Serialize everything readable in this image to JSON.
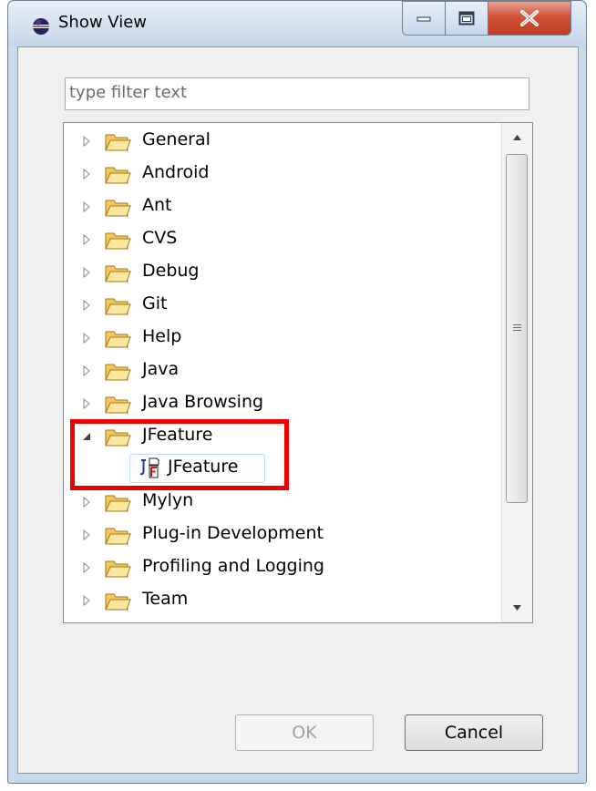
{
  "window": {
    "title": "Show View",
    "icon": "eclipse-icon",
    "controls": [
      "minimize-icon",
      "maximize-icon",
      "close-icon"
    ]
  },
  "filter": {
    "placeholder": "type filter text",
    "value": ""
  },
  "tree": {
    "items": [
      {
        "label": "General",
        "expanded": false
      },
      {
        "label": "Android",
        "expanded": false
      },
      {
        "label": "Ant",
        "expanded": false
      },
      {
        "label": "CVS",
        "expanded": false
      },
      {
        "label": "Debug",
        "expanded": false
      },
      {
        "label": "Git",
        "expanded": false
      },
      {
        "label": "Help",
        "expanded": false
      },
      {
        "label": "Java",
        "expanded": false
      },
      {
        "label": "Java Browsing",
        "expanded": false
      },
      {
        "label": "JFeature",
        "expanded": true,
        "children": [
          {
            "label": "JFeature",
            "icon": "jfeature-icon"
          }
        ]
      },
      {
        "label": "Mylyn",
        "expanded": false
      },
      {
        "label": "Plug-in Development",
        "expanded": false
      },
      {
        "label": "Profiling and Logging",
        "expanded": false
      },
      {
        "label": "Team",
        "expanded": false
      }
    ]
  },
  "buttons": {
    "ok": "OK",
    "cancel": "Cancel"
  },
  "colors": {
    "highlight": "#ee0000",
    "folder": "#e8b844",
    "close_button": "#c8452c"
  }
}
